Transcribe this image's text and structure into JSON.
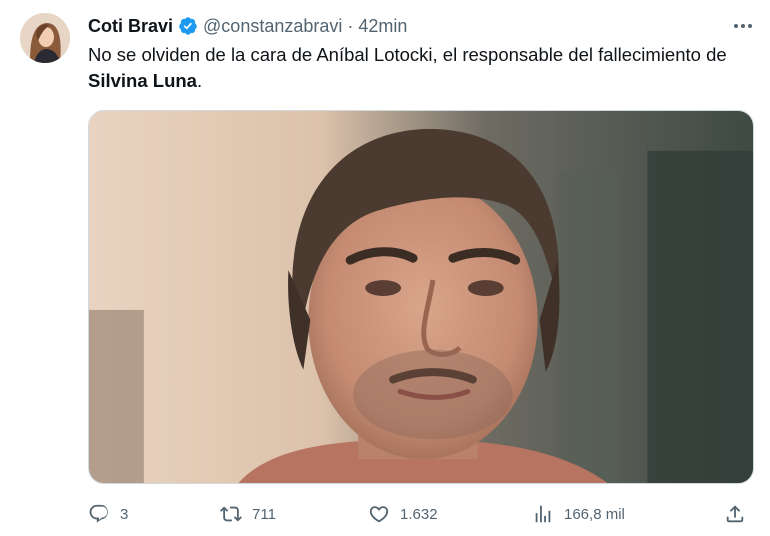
{
  "tweet": {
    "author_name": "Coti Bravi",
    "handle": "@constanzabravi",
    "separator": "·",
    "time": "42min",
    "text_part1": "No se olviden de la cara de Aníbal Lotocki, el responsable del fallecimiento de ",
    "text_bold": "Silvina Luna",
    "text_end": "."
  },
  "icons": {
    "verified": "verified-badge-icon",
    "more": "more-options-icon",
    "reply": "reply-icon",
    "retweet": "retweet-icon",
    "like": "like-icon",
    "views": "views-icon",
    "share": "share-icon"
  },
  "stats": {
    "replies": "3",
    "retweets": "711",
    "likes": "1.632",
    "views": "166,8 mil"
  },
  "colors": {
    "text": "#0f1419",
    "secondary": "#536471",
    "verified": "#1d9bf0"
  }
}
